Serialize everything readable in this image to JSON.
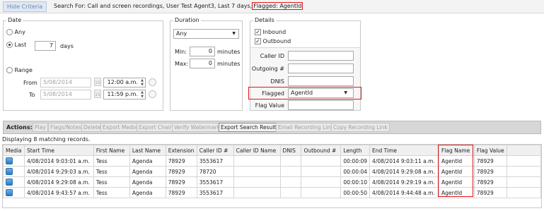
{
  "topbar": {
    "hide_label": "Hide Criteria",
    "search_text": "Search For:  Call and screen recordings, User Test Agent3, Last 7 days,",
    "search_flagged": "Flagged: AgentId"
  },
  "date_panel": {
    "title": "Date",
    "any_label": "Any",
    "last_label": "Last",
    "last_value": "7",
    "days_label": "days",
    "range_label": "Range",
    "from_label": "From",
    "from_date": "5/08/2014",
    "from_time": "12:00 a.m.",
    "to_label": "To",
    "to_date": "5/08/2014",
    "to_time": "11:59 p.m.",
    "calendar_glyph": "15"
  },
  "duration_panel": {
    "title": "Duration",
    "select_value": "Any",
    "min_label": "Min:",
    "min_value": "0",
    "max_label": "Max:",
    "max_value": "0",
    "unit_label": "minutes"
  },
  "details_panel": {
    "title": "Details",
    "inbound_label": "Inbound",
    "outbound_label": "Outbound",
    "caller_id_label": "Caller ID",
    "outgoing_label": "Outgoing #",
    "dnis_label": "DNIS",
    "flagged_label": "Flagged",
    "flagged_value": "AgentId",
    "flag_value_label": "Flag Value"
  },
  "actions": {
    "label": "Actions:",
    "play": "Play",
    "flags_notes": "Flags/Notes",
    "delete": "Delete",
    "export_media": "Export Media",
    "export_chain": "Export Chain",
    "verify_watermark": "Verify Watermark",
    "export_results": "Export Search Results",
    "email_link": "Email Recording Link",
    "copy_link": "Copy Recording Link"
  },
  "results": {
    "count_text": "Displaying 8 matching records.",
    "columns": [
      "Media",
      "Start Time",
      "First Name",
      "Last Name",
      "Extension",
      "Caller ID #",
      "Caller ID Name",
      "DNIS",
      "Outbound #",
      "Length",
      "End Time",
      "Flag Name",
      "Flag Value"
    ],
    "rows": [
      [
        "",
        "4/08/2014 9:03:01 a.m.",
        "Tess",
        "Agenda",
        "78929",
        "3553617",
        "",
        "",
        "",
        "00:00:09",
        "4/08/2014 9:03:11 a.m.",
        "AgentId",
        "78929"
      ],
      [
        "",
        "4/08/2014 9:29:03 a.m.",
        "Tess",
        "Agenda",
        "78929",
        "78720",
        "",
        "",
        "",
        "00:00:04",
        "4/08/2014 9:29:08 a.m.",
        "AgentId",
        "78929"
      ],
      [
        "",
        "4/08/2014 9:29:08 a.m.",
        "Tess",
        "Agenda",
        "78929",
        "3553617",
        "",
        "",
        "",
        "00:00:10",
        "4/08/2014 9:29:19 a.m.",
        "AgentId",
        "78929"
      ],
      [
        "",
        "4/08/2014 9:43:57 a.m.",
        "Tess",
        "Agenda",
        "78929",
        "3553617",
        "",
        "",
        "",
        "00:00:50",
        "4/08/2014 9:44:48 a.m.",
        "AgentId",
        "78929"
      ]
    ]
  },
  "colors": {
    "highlight": "#e0151b",
    "media_icon": "#2a78c4"
  }
}
